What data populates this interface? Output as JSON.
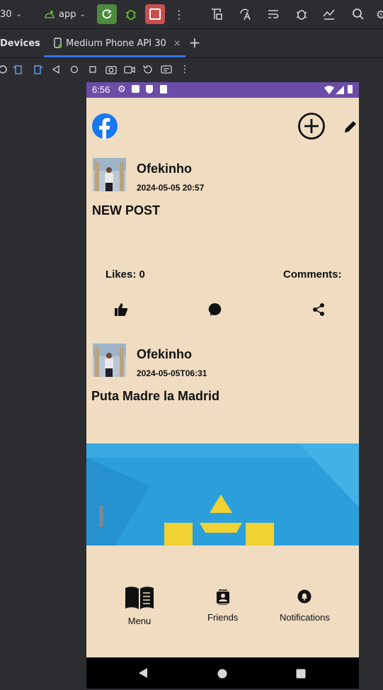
{
  "toolbar": {
    "config_label": "30",
    "run_config": "app"
  },
  "tabs": {
    "devices_label": "Devices",
    "active_tab_label": "Medium Phone API 30"
  },
  "phone": {
    "status_time": "6:56",
    "posts": [
      {
        "author": "Ofekinho",
        "date": "2024-05-05 20:57",
        "text": "NEW POST",
        "likes_label": "Likes: 0",
        "comments_label": "Comments:"
      },
      {
        "author": "Ofekinho",
        "date": "2024-05-05T06:31",
        "text": "Puta Madre la Madrid"
      }
    ],
    "nav": {
      "menu": "Menu",
      "friends": "Friends",
      "notifications": "Notifications"
    }
  },
  "colors": {
    "ide_bg": "#2b2d30",
    "phone_bg": "#efdcc1",
    "status_bar": "#6b4ca6",
    "run_green": "#4e8a3e",
    "stop_red": "#c94f4f",
    "tab_accent": "#3574f0",
    "facebook_blue": "#1877f2"
  }
}
